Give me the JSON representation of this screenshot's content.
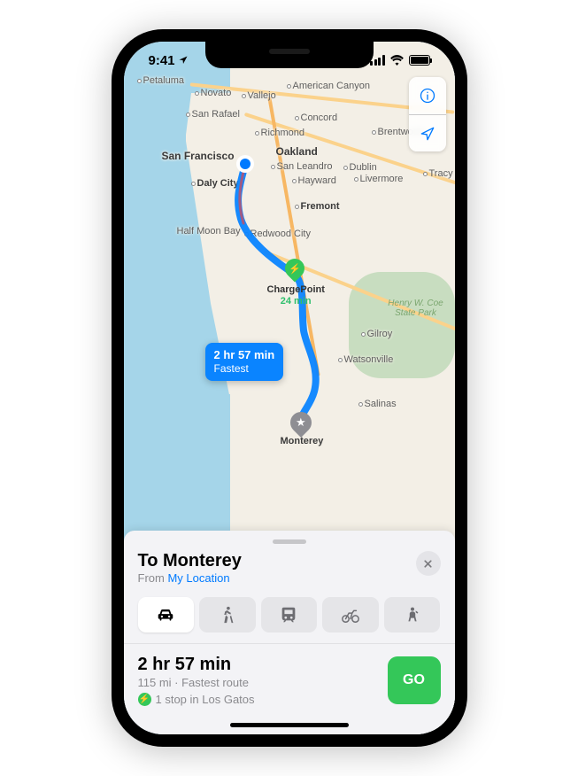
{
  "status": {
    "time": "9:41"
  },
  "map": {
    "cities": {
      "petaluma": "Petaluma",
      "novato": "Novato",
      "vallejo": "Vallejo",
      "san_rafael": "San Rafael",
      "american_canyon": "American Canyon",
      "concord": "Concord",
      "richmond": "Richmond",
      "brentwood": "Brentwood",
      "san_francisco": "San Francisco",
      "oakland": "Oakland",
      "dublin": "Dublin",
      "san_leandro": "San Leandro",
      "hayward": "Hayward",
      "livermore": "Livermore",
      "tracy": "Tracy",
      "daly_city": "Daly City",
      "fremont": "Fremont",
      "half_moon_bay": "Half Moon Bay",
      "redwood_city": "Redwood City",
      "gilroy": "Gilroy",
      "watsonville": "Watsonville",
      "salinas": "Salinas",
      "monterey": "Monterey"
    },
    "park": "Henry W. Coe\nState Park",
    "charge_stop": {
      "name": "ChargePoint",
      "duration": "24 min"
    },
    "route_callout": {
      "duration": "2 hr 57 min",
      "label": "Fastest"
    }
  },
  "card": {
    "title": "To Monterey",
    "from_prefix": "From ",
    "from_link": "My Location",
    "route": {
      "duration": "2 hr 57 min",
      "meta": "115 mi · Fastest route",
      "ev_stop": "1 stop in Los Gatos"
    },
    "go": "GO"
  },
  "modes": [
    "drive",
    "walk",
    "transit",
    "cycle",
    "ride"
  ]
}
